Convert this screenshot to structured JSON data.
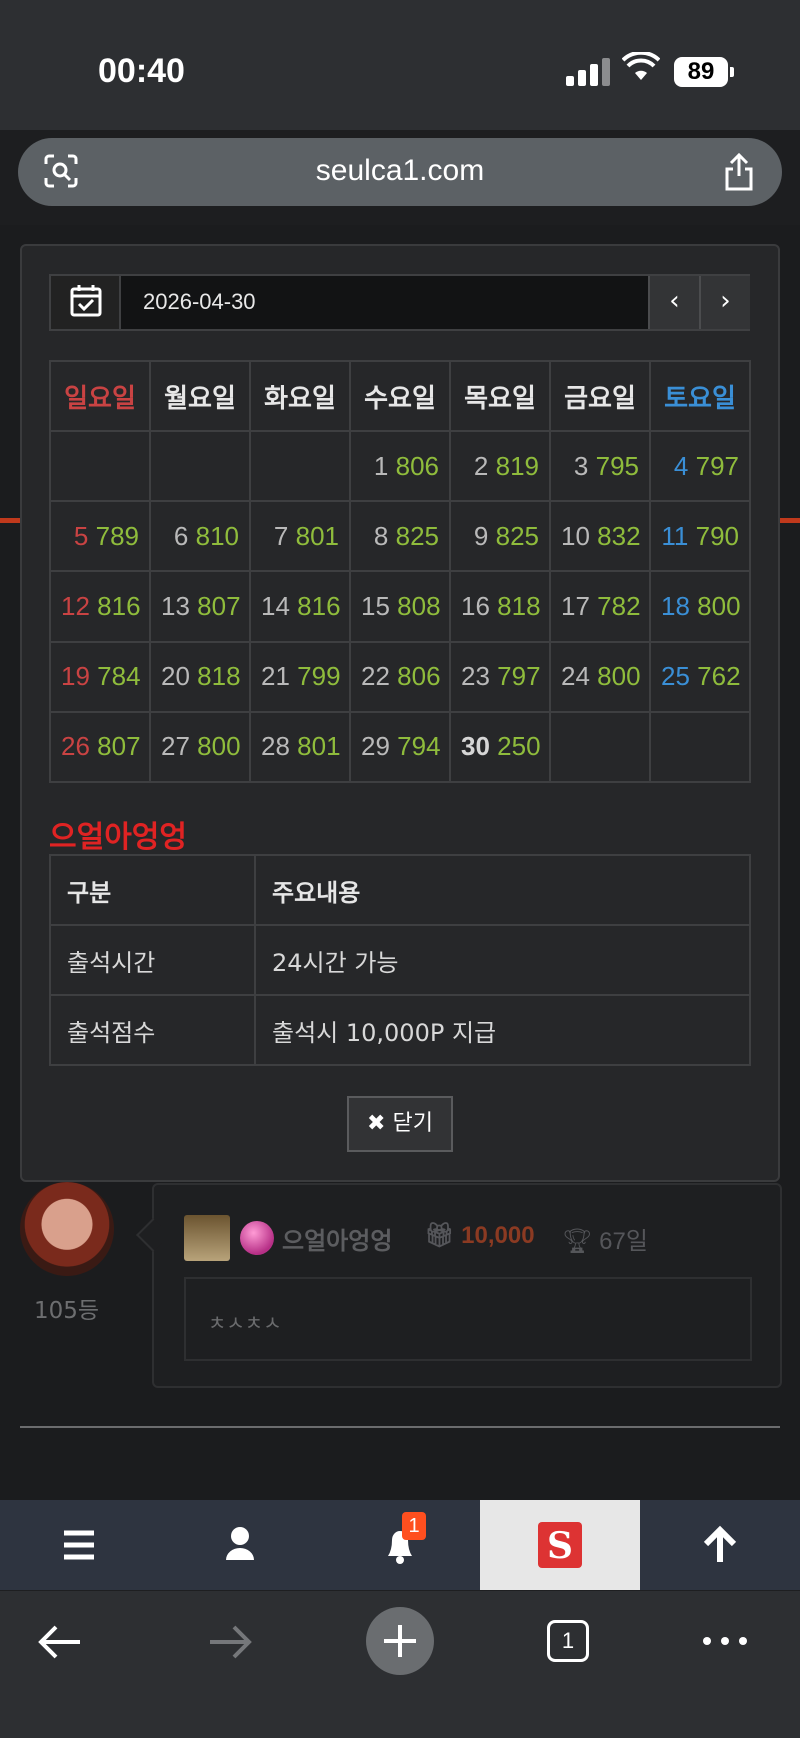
{
  "status_bar": {
    "time": "00:40",
    "battery": "89"
  },
  "browser": {
    "url": "seulca1.com",
    "tab_count": "1"
  },
  "date_picker": {
    "date": "2026-04-30",
    "prev_label": "‹",
    "next_label": "›"
  },
  "calendar": {
    "weekdays": [
      "일요일",
      "월요일",
      "화요일",
      "수요일",
      "목요일",
      "금요일",
      "토요일"
    ],
    "weeks": [
      [
        null,
        null,
        null,
        {
          "day": "1",
          "score": "806"
        },
        {
          "day": "2",
          "score": "819"
        },
        {
          "day": "3",
          "score": "795"
        },
        {
          "day": "4",
          "score": "797"
        }
      ],
      [
        {
          "day": "5",
          "score": "789"
        },
        {
          "day": "6",
          "score": "810"
        },
        {
          "day": "7",
          "score": "801"
        },
        {
          "day": "8",
          "score": "825"
        },
        {
          "day": "9",
          "score": "825"
        },
        {
          "day": "10",
          "score": "832"
        },
        {
          "day": "11",
          "score": "790"
        }
      ],
      [
        {
          "day": "12",
          "score": "816"
        },
        {
          "day": "13",
          "score": "807"
        },
        {
          "day": "14",
          "score": "816"
        },
        {
          "day": "15",
          "score": "808"
        },
        {
          "day": "16",
          "score": "818"
        },
        {
          "day": "17",
          "score": "782"
        },
        {
          "day": "18",
          "score": "800"
        }
      ],
      [
        {
          "day": "19",
          "score": "784"
        },
        {
          "day": "20",
          "score": "818"
        },
        {
          "day": "21",
          "score": "799"
        },
        {
          "day": "22",
          "score": "806"
        },
        {
          "day": "23",
          "score": "797"
        },
        {
          "day": "24",
          "score": "800"
        },
        {
          "day": "25",
          "score": "762"
        }
      ],
      [
        {
          "day": "26",
          "score": "807"
        },
        {
          "day": "27",
          "score": "800"
        },
        {
          "day": "28",
          "score": "801"
        },
        {
          "day": "29",
          "score": "794"
        },
        {
          "day": "30",
          "score": "250",
          "today": true
        },
        null,
        null
      ]
    ]
  },
  "info": {
    "title": "으얼아엉엉",
    "header": [
      "구분",
      "주요내용"
    ],
    "rows": [
      [
        "출석시간",
        "24시간 가능"
      ],
      [
        "출석점수",
        "출석시 10,000P 지급"
      ]
    ]
  },
  "close_button": {
    "icon": "close-x-icon",
    "label": "닫기"
  },
  "comment": {
    "rank": "105등",
    "username": "으얼아엉엉",
    "points": "10,000",
    "days": "67일",
    "text": "ㅊㅅㅊㅅ"
  },
  "bottom_nav": {
    "items": [
      "menu-icon",
      "user-icon",
      "bell-icon",
      "site-logo",
      "arrow-up-icon"
    ],
    "notification_count": "1"
  },
  "colors": {
    "sunday": "#c94343",
    "saturday": "#3a8fd6",
    "score": "#8fbc3c",
    "accent_red": "#e02323"
  }
}
